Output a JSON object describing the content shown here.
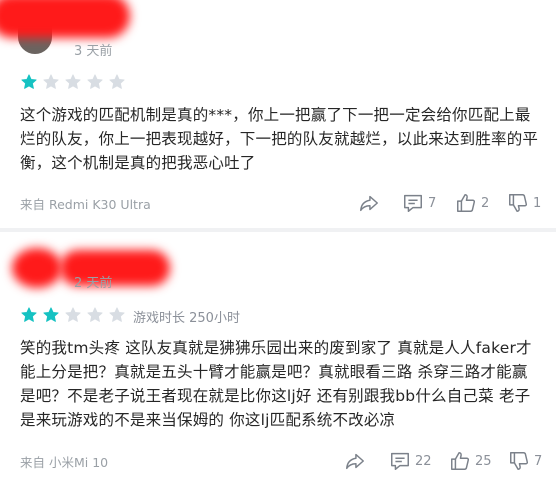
{
  "reviews": [
    {
      "time": "3 天前",
      "rating": 1,
      "max_rating": 5,
      "playtime": "",
      "content": "这个游戏的匹配机制是真的***，你上一把赢了下一把一定会给你匹配上最烂的队友，你上一把表现越好，下一把的队友就越烂，以此来达到胜率的平衡，这个机制是真的把我恶心吐了",
      "device": "来自 Redmi K30 Ultra",
      "comments": "7",
      "likes": "2",
      "dislikes": "1"
    },
    {
      "time": "2 天前",
      "rating": 2,
      "max_rating": 5,
      "playtime": "游戏时长 250小时",
      "content": "笑的我tm头疼 这队友真就是狒狒乐园出来的废到家了 真就是人人faker才能上分是把？真就是五头十臂才能赢是吧？真就眼看三路 杀穿三路才能赢是吧？不是老子说王者现在就是比你这lj好 还有别跟我bb什么自己菜 老子是来玩游戏的不是来当保姆的 你这lj匹配系统不改必凉",
      "device": "来自 小米Mi 10",
      "comments": "22",
      "likes": "25",
      "dislikes": "7"
    }
  ],
  "colors": {
    "star_active": "#16c2c2",
    "star_inactive": "#d8dde3",
    "redaction": "#ff1a1a",
    "icon": "#7b818a"
  },
  "icons": [
    "share-icon",
    "comment-icon",
    "thumbs-up-icon",
    "thumbs-down-icon"
  ]
}
